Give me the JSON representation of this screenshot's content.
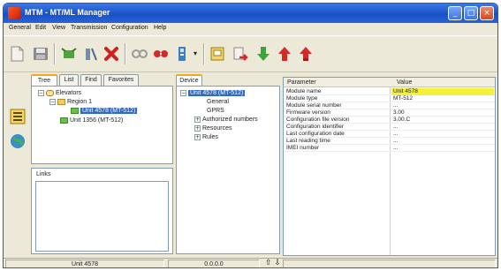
{
  "window": {
    "title": "MTM - MT/ML Manager"
  },
  "title_buttons": {
    "minimize": "_",
    "maximize": "□",
    "close": "×"
  },
  "menu": [
    "General",
    "Edit",
    "View",
    "Transmission",
    "Configuration",
    "Help"
  ],
  "toolbar": {
    "buttons": [
      {
        "icon": "new-file-icon",
        "color": "#e9e7de"
      },
      {
        "icon": "save-icon",
        "color": "#8a8a8a"
      },
      {
        "icon": "connect-device-icon",
        "color": "#4aa53a"
      },
      {
        "icon": "disconnect-device-icon",
        "color": "#6b8fb0"
      },
      {
        "icon": "delete-icon",
        "color": "#d02020"
      },
      {
        "icon": "link-gray-icon",
        "color": "#9a9a9a"
      },
      {
        "icon": "link-red-icon",
        "color": "#d42a2a"
      },
      {
        "icon": "device-config-icon",
        "color": "#3c7ec4"
      },
      {
        "icon": "dropdown-icon",
        "color": "#333333"
      },
      {
        "icon": "phonebook-icon",
        "color": "#c8a020"
      },
      {
        "icon": "send-config-icon",
        "color": "#d42a2a"
      },
      {
        "icon": "download-arrow-icon",
        "color": "#3aa63a"
      },
      {
        "icon": "upload-arrow-icon",
        "color": "#d42a2a"
      },
      {
        "icon": "upload-arrow-alt-icon",
        "color": "#d42a2a"
      }
    ]
  },
  "left_panel": {
    "tabs": [
      "Tree",
      "List",
      "Find",
      "Favorites"
    ],
    "active_tab": "Tree",
    "tree": {
      "root": "Elevators",
      "group": "Region 1",
      "items": [
        "Unit 4578 (MT-512)",
        "Unit 1356 (MT-512)"
      ]
    }
  },
  "links_panel": {
    "title": "Links"
  },
  "device_panel": {
    "tab": "Device",
    "root": "Unit 4578 (MT-512)",
    "children": [
      {
        "label": "General",
        "expandable": false
      },
      {
        "label": "GPRS",
        "expandable": false
      },
      {
        "label": "Authorized numbers",
        "expandable": true
      },
      {
        "label": "Resources",
        "expandable": true
      },
      {
        "label": "Rules",
        "expandable": true
      }
    ]
  },
  "grid": {
    "headers": {
      "param": "Parameter",
      "value": "Value"
    },
    "rows": [
      {
        "param": "Module name",
        "value": "Unit 4578",
        "highlight": true
      },
      {
        "param": "Module type",
        "value": "MT-512",
        "highlight": false
      },
      {
        "param": "Module serial number",
        "value": "...",
        "highlight": false
      },
      {
        "param": "Firmware version",
        "value": "3.00",
        "highlight": false
      },
      {
        "param": "Configuration file version",
        "value": "3.00.C",
        "highlight": false
      },
      {
        "param": "Configuration identifier",
        "value": "...",
        "highlight": false
      },
      {
        "param": "Last configuration date",
        "value": "...",
        "highlight": false
      },
      {
        "param": "Last reading time",
        "value": "...",
        "highlight": false
      },
      {
        "param": "IMEI number",
        "value": "...",
        "highlight": false
      }
    ]
  },
  "status": {
    "unit": "Unit 4578",
    "counter": "0.0.0.0",
    "arrows": "⇧ ⇩"
  },
  "colors": {
    "titlebar": "#1f57d0",
    "selection": "#316ac5",
    "highlight": "#f5f03a",
    "tab_accent": "#f5a81c"
  }
}
